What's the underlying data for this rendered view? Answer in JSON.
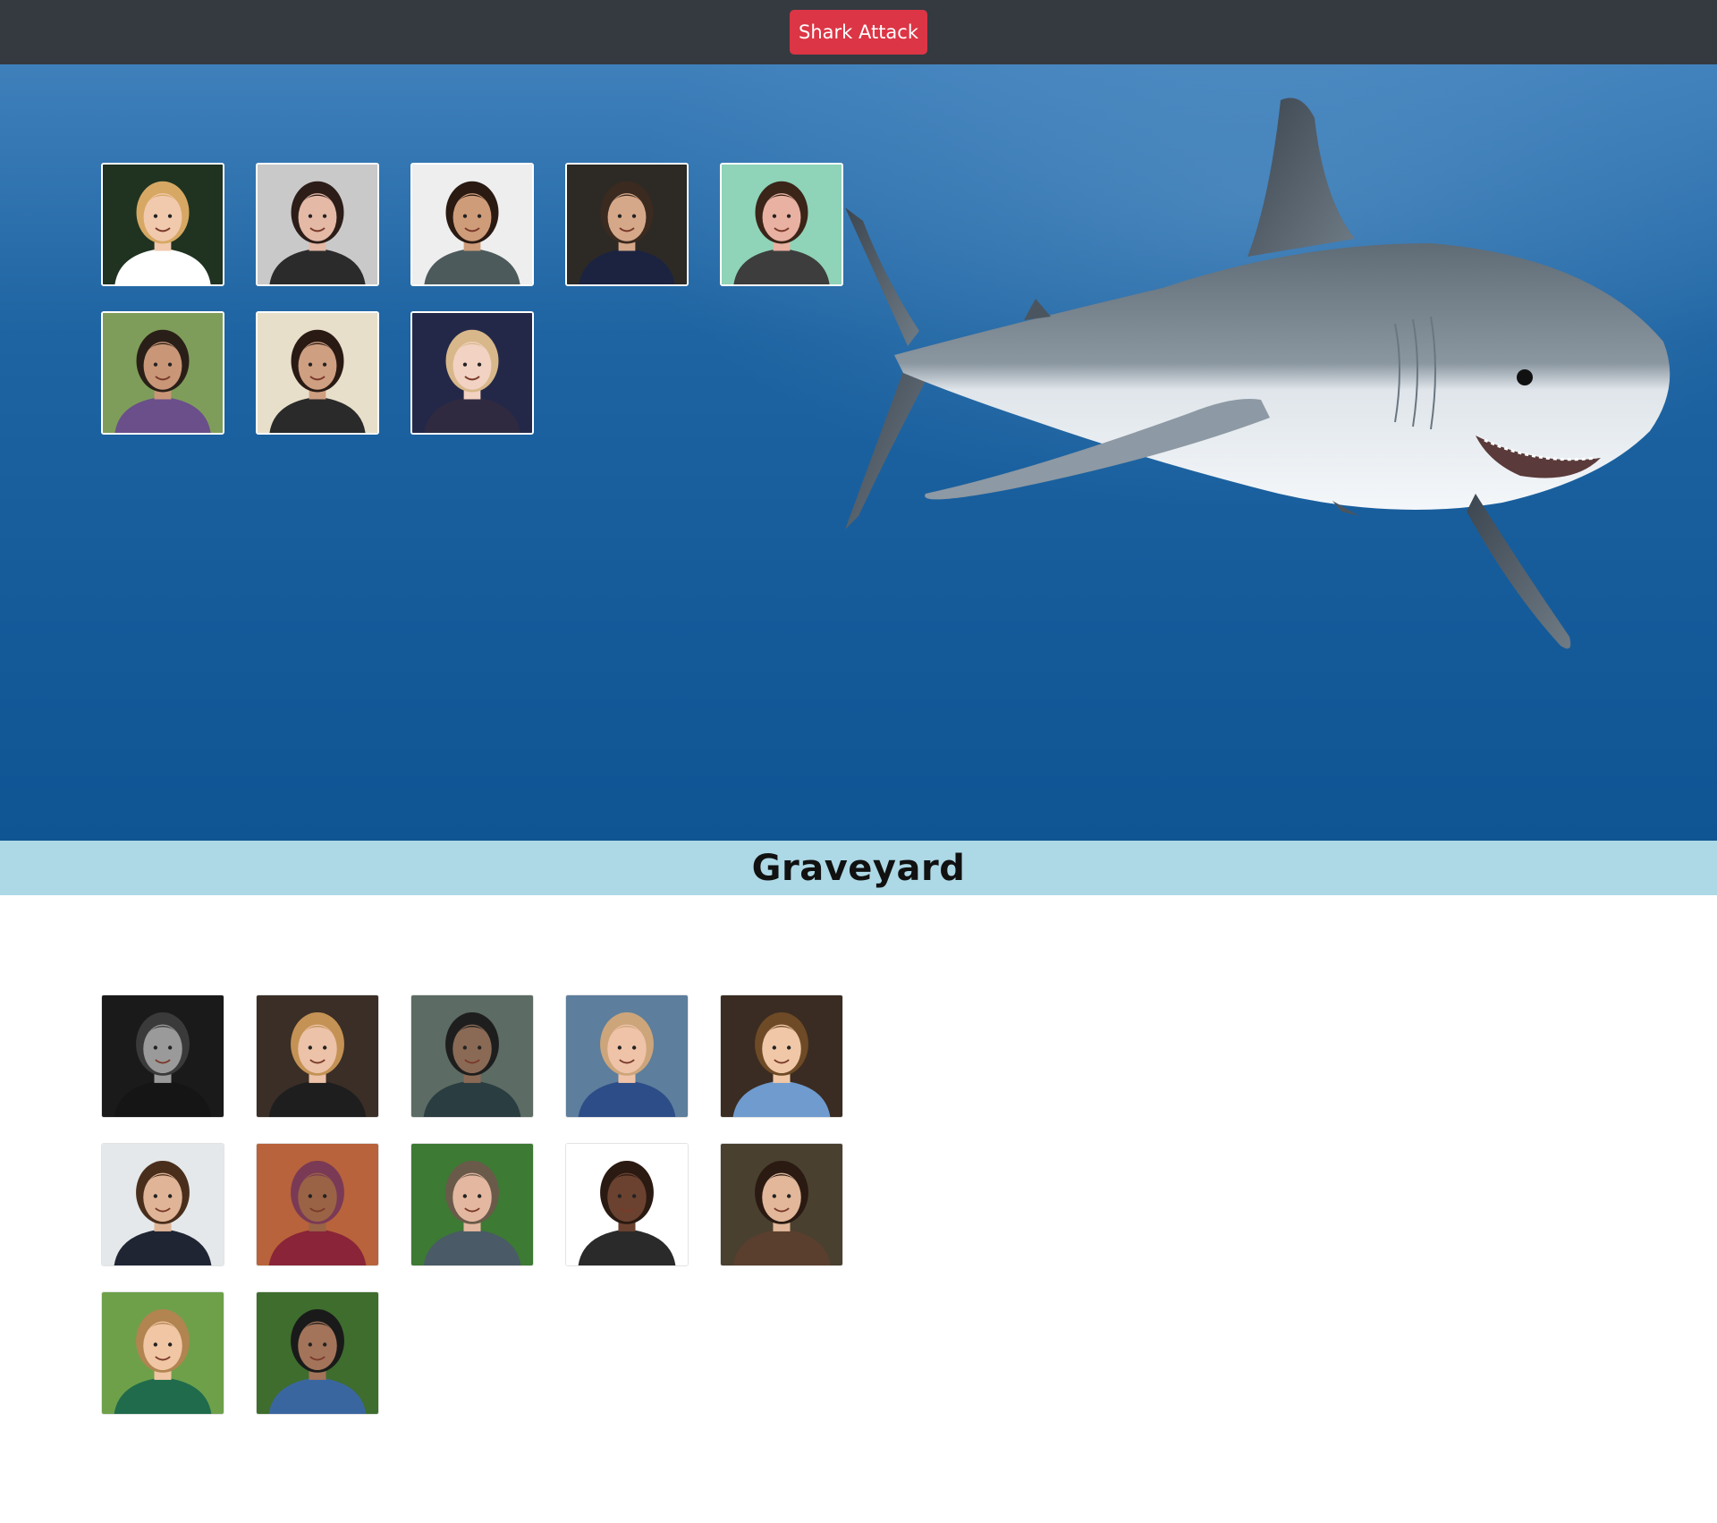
{
  "navbar": {
    "attack_button_label": "Shark Attack",
    "background": "#343a40",
    "button_color": "#dc3545"
  },
  "ocean": {
    "background": "#1e64a2",
    "image_icon": "great-white-shark",
    "survivors": [
      {
        "name": "survivor-1",
        "bg": "#1f3320",
        "skin": "#f1c9ad",
        "hair": "#d7a863",
        "shirt": "#ffffff"
      },
      {
        "name": "survivor-2",
        "bg": "#c9c9c9",
        "skin": "#e4b9a6",
        "hair": "#2c1d18",
        "shirt": "#2b2b2b"
      },
      {
        "name": "survivor-3",
        "bg": "#eeeeee",
        "skin": "#cf9c7a",
        "hair": "#2a1a12",
        "shirt": "#4c5a5c"
      },
      {
        "name": "survivor-4",
        "bg": "#2d2a25",
        "skin": "#d6a88a",
        "hair": "#3b2a1f",
        "shirt": "#1b2340"
      },
      {
        "name": "survivor-5",
        "bg": "#8fd3b8",
        "skin": "#e9b1a1",
        "hair": "#3b2418",
        "shirt": "#3d3d3d"
      },
      {
        "name": "survivor-6",
        "bg": "#7f9d5a",
        "skin": "#c99778",
        "hair": "#2a1f18",
        "shirt": "#6a4f8a"
      },
      {
        "name": "survivor-7",
        "bg": "#e8dfca",
        "skin": "#cf9f82",
        "hair": "#2a1a14",
        "shirt": "#2a2a2a"
      },
      {
        "name": "survivor-8",
        "bg": "#242848",
        "skin": "#f2d2c2",
        "hair": "#d8b88a",
        "shirt": "#2f2a40"
      }
    ]
  },
  "graveyard": {
    "title": "Graveyard",
    "header_background": "#add8e6",
    "victims": [
      {
        "name": "victim-1",
        "bg": "#1a1a1a",
        "skin": "#9a9a9a",
        "hair": "#3a3a3a",
        "shirt": "#151515"
      },
      {
        "name": "victim-2",
        "bg": "#3a2e26",
        "skin": "#ecc2a8",
        "hair": "#c49254",
        "shirt": "#1e1e1e"
      },
      {
        "name": "victim-3",
        "bg": "#5c6b63",
        "skin": "#8a6a55",
        "hair": "#1e1e1e",
        "shirt": "#2a3d40"
      },
      {
        "name": "victim-4",
        "bg": "#5d7e9c",
        "skin": "#efc3a8",
        "hair": "#cda57b",
        "shirt": "#2d4d88"
      },
      {
        "name": "victim-5",
        "bg": "#3a2c22",
        "skin": "#f0c8a8",
        "hair": "#6e4a26",
        "shirt": "#6f9bcf"
      },
      {
        "name": "victim-6",
        "bg": "#e4e8ea",
        "skin": "#e0b597",
        "hair": "#4a2e1c",
        "shirt": "#1f2533"
      },
      {
        "name": "victim-7",
        "bg": "#b8633b",
        "skin": "#9a6346",
        "hair": "#7a3a55",
        "shirt": "#8a2438"
      },
      {
        "name": "victim-8",
        "bg": "#3d7a34",
        "skin": "#e4b8a0",
        "hair": "#6a5a4a",
        "shirt": "#4a5a66"
      },
      {
        "name": "victim-9",
        "bg": "#ffffff",
        "skin": "#6b4230",
        "hair": "#2a1a12",
        "shirt": "#2a2a2a"
      },
      {
        "name": "victim-10",
        "bg": "#4a4030",
        "skin": "#e2b79a",
        "hair": "#2a1a12",
        "shirt": "#5a3f2e"
      },
      {
        "name": "victim-11",
        "bg": "#6ea04a",
        "skin": "#f0c6a4",
        "hair": "#b18450",
        "shirt": "#1f6b4c"
      },
      {
        "name": "victim-12",
        "bg": "#3e6d2d",
        "skin": "#a3745a",
        "hair": "#1a1a1a",
        "shirt": "#3a66a0"
      }
    ]
  }
}
